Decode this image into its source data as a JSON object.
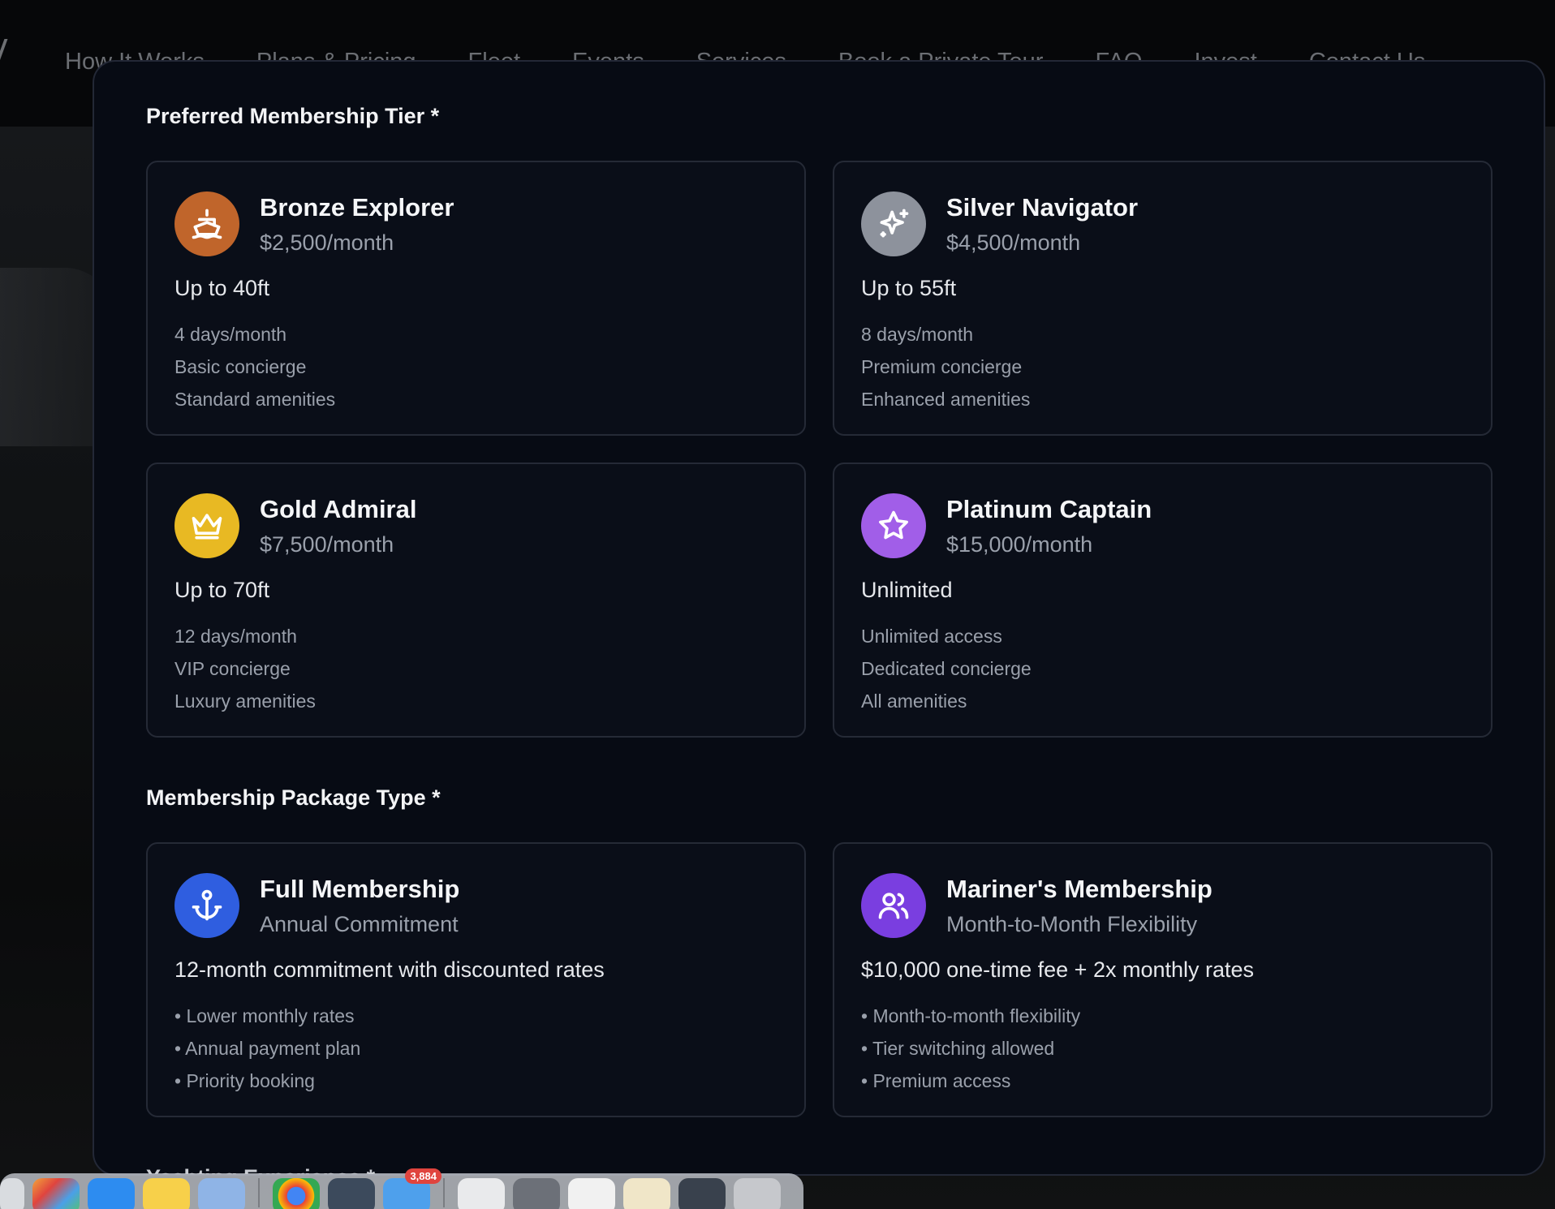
{
  "background": {
    "nav": [
      "How It Works",
      "Plans & Pricing",
      "Fleet",
      "Events",
      "Services",
      "Book a Private Tour",
      "FAQ",
      "Invest",
      "Contact Us"
    ]
  },
  "tier_section": {
    "label": "Preferred Membership Tier *",
    "cards": [
      {
        "name": "Bronze Explorer",
        "price": "$2,500/month",
        "length": "Up to 40ft",
        "features": [
          "4 days/month",
          "Basic concierge",
          "Standard amenities"
        ],
        "icon": "ship-icon",
        "color": "#c0652b"
      },
      {
        "name": "Silver Navigator",
        "price": "$4,500/month",
        "length": "Up to 55ft",
        "features": [
          "8 days/month",
          "Premium concierge",
          "Enhanced amenities"
        ],
        "icon": "sparkle-icon",
        "color": "#8d929c"
      },
      {
        "name": "Gold Admiral",
        "price": "$7,500/month",
        "length": "Up to 70ft",
        "features": [
          "12 days/month",
          "VIP concierge",
          "Luxury amenities"
        ],
        "icon": "crown-icon",
        "color": "#e8b923"
      },
      {
        "name": "Platinum Captain",
        "price": "$15,000/month",
        "length": "Unlimited",
        "features": [
          "Unlimited access",
          "Dedicated concierge",
          "All amenities"
        ],
        "icon": "star-icon",
        "color": "#a15ee8"
      }
    ]
  },
  "package_section": {
    "label": "Membership Package Type *",
    "cards": [
      {
        "name": "Full Membership",
        "subtitle": "Annual Commitment",
        "headline": "12-month commitment with discounted rates",
        "features": [
          "• Lower monthly rates",
          "• Annual payment plan",
          "• Priority booking"
        ],
        "icon": "anchor-icon",
        "color": "#2f5ee0"
      },
      {
        "name": "Mariner's Membership",
        "subtitle": "Month-to-Month Flexibility",
        "headline": "$10,000 one-time fee + 2x monthly rates",
        "features": [
          "• Month-to-month flexibility",
          "• Tier switching allowed",
          "• Premium access"
        ],
        "icon": "users-icon",
        "color": "#7a3ee0"
      }
    ]
  },
  "next_section": {
    "label": "Yachting Experience *"
  },
  "dock": {
    "mail_badge": "3,884"
  }
}
